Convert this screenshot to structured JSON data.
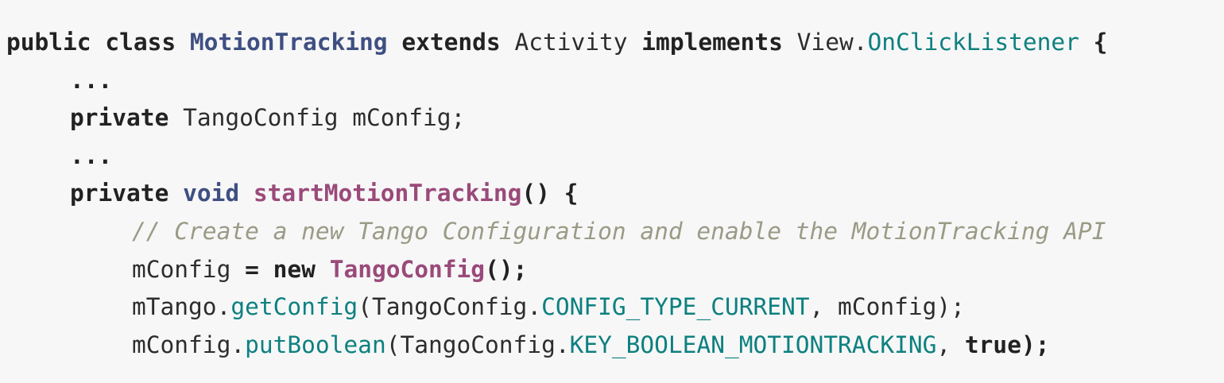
{
  "code": {
    "line1": {
      "kw_public": "public",
      "kw_class": "class",
      "class_name": "MotionTracking",
      "kw_extends": "extends",
      "super_class": "Activity",
      "kw_implements": "implements",
      "iface_prefix": "View.",
      "iface_name": "OnClickListener",
      "open_brace": "{"
    },
    "line2": {
      "ellipsis": "..."
    },
    "line3": {
      "kw_private": "private",
      "rest": "TangoConfig mConfig;"
    },
    "line4": {
      "ellipsis": "..."
    },
    "line5": {
      "kw_private": "private",
      "kw_void": "void",
      "method_name": "startMotionTracking",
      "params_brace": "() {"
    },
    "line6": {
      "comment": "// Create a new Tango Configuration and enable the MotionTracking API"
    },
    "line7": {
      "lhs": "mConfig",
      "assign": "=",
      "kw_new": "new",
      "ctor_name": "TangoConfig",
      "tail": "();"
    },
    "line8": {
      "receiver": "mTango.",
      "method": "getConfig",
      "arg_prefix": "(TangoConfig.",
      "constant": "CONFIG_TYPE_CURRENT",
      "tail": ", mConfig);"
    },
    "line9": {
      "receiver": "mConfig.",
      "method": "putBoolean",
      "arg_prefix": "(TangoConfig.",
      "constant": "KEY_BOOLEAN_MOTIONTRACKING",
      "comma": ",",
      "literal_true": "true",
      "tail": ");"
    }
  }
}
